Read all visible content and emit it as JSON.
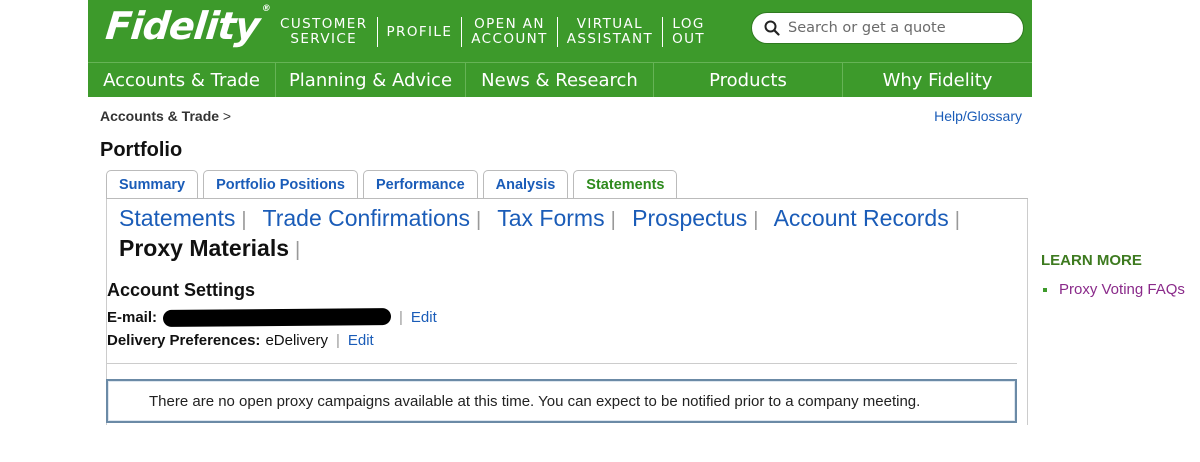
{
  "brand": {
    "logo": "Fidelity",
    "registered": "®",
    "accent": "#3d9a2b"
  },
  "utility_nav": [
    {
      "line1": "CUSTOMER",
      "line2": "SERVICE"
    },
    {
      "line1": "PROFILE",
      "line2": ""
    },
    {
      "line1": "OPEN AN",
      "line2": "ACCOUNT"
    },
    {
      "line1": "VIRTUAL",
      "line2": "ASSISTANT"
    },
    {
      "line1": "LOG",
      "line2": "OUT"
    }
  ],
  "search": {
    "placeholder": "Search or get a quote",
    "icon": "search-icon"
  },
  "main_nav": [
    "Accounts & Trade",
    "Planning & Advice",
    "News & Research",
    "Products",
    "Why Fidelity"
  ],
  "breadcrumb": {
    "label": "Accounts & Trade",
    "separator": ">"
  },
  "help_link": "Help/Glossary",
  "page_title": "Portfolio",
  "tabs": [
    "Summary",
    "Portfolio Positions",
    "Performance",
    "Analysis",
    "Statements"
  ],
  "active_tab": "Statements",
  "subnav": [
    "Statements",
    "Trade Confirmations",
    "Tax Forms",
    "Prospectus",
    "Account Records",
    "Proxy Materials"
  ],
  "active_subnav": "Proxy Materials",
  "account_settings": {
    "title": "Account Settings",
    "email_label": "E-mail:",
    "email_edit": "Edit",
    "delivery_label": "Delivery Preferences:",
    "delivery_value": "eDelivery",
    "delivery_edit": "Edit"
  },
  "notice": "There are no open proxy campaigns available at this time. You can expect to be notified prior to a company meeting.",
  "learn_more": {
    "title": "LEARN MORE",
    "link": "Proxy Voting FAQs"
  }
}
